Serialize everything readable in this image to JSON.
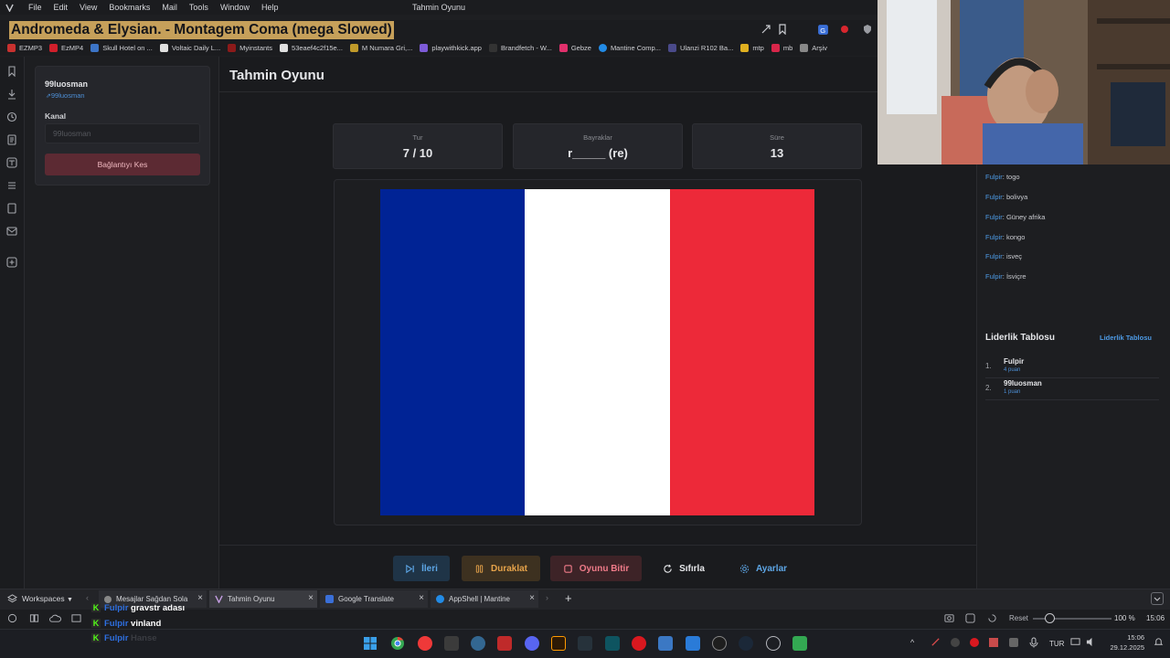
{
  "menubar": {
    "items": [
      "File",
      "Edit",
      "View",
      "Bookmarks",
      "Mail",
      "Tools",
      "Window",
      "Help"
    ],
    "window_title": "Tahmin Oyunu"
  },
  "now_playing": "Andromeda & Elysian. - Montagem Coma (mega Slowed)",
  "bookmarks": [
    "EZMP3",
    "EzMP4",
    "Skull Hotel on ...",
    "Voltaic Daily L...",
    "Myinstants",
    "53eaef4c2f15e...",
    "M Numara Gri,...",
    "playwithkick.app",
    "Brandfetch - W...",
    "Gebze",
    "Mantine Comp...",
    "Ulanzi R102 Ba...",
    "mtp",
    "mb",
    "Arşiv"
  ],
  "sidebar": {
    "username": "99luosman",
    "handle": "99luosman",
    "channel_label": "Kanal",
    "channel_placeholder": "99luosman",
    "disconnect_label": "Bağlantıyı Kes"
  },
  "game": {
    "title": "Tahmin Oyunu",
    "stats": [
      {
        "label": "Tur",
        "value": "7 / 10"
      },
      {
        "label": "Bayraklar",
        "value": "r_____ (re)"
      },
      {
        "label": "Süre",
        "value": "13"
      }
    ],
    "flag_colors": [
      "#002395",
      "#FFFFFF",
      "#ED2939"
    ],
    "actions": [
      {
        "label": "İleri",
        "icon": "skip-icon"
      },
      {
        "label": "Duraklat",
        "icon": "pause-icon"
      },
      {
        "label": "Oyunu Bitir",
        "icon": "stop-icon"
      },
      {
        "label": "Sıfırla",
        "icon": "refresh-icon"
      },
      {
        "label": "Ayarlar",
        "icon": "settings-icon"
      }
    ]
  },
  "chat": [
    {
      "user": "Fulpir",
      "text": "togo"
    },
    {
      "user": "Fulpir",
      "text": "bolivya"
    },
    {
      "user": "Fulpir",
      "text": "Güney afrika"
    },
    {
      "user": "Fulpir",
      "text": "kongo"
    },
    {
      "user": "Fulpir",
      "text": "isveç"
    },
    {
      "user": "Fulpir",
      "text": "İsviçre"
    }
  ],
  "leaderboard": {
    "title": "Liderlik Tablosu",
    "link": "Liderlik Tablosu",
    "rows": [
      {
        "rank": "1.",
        "name": "Fulpir",
        "points": "4 puan"
      },
      {
        "rank": "2.",
        "name": "99luosman",
        "points": "1 puan"
      }
    ]
  },
  "workspaces": {
    "label": "Workspaces",
    "tabs": [
      "Mesajlar Sağdan Sola",
      "Tahmin Oyunu",
      "Google Translate",
      "AppShell | Mantine"
    ]
  },
  "statusbar": {
    "reset": "Reset",
    "zoom": "100 %",
    "time": "15:06"
  },
  "overlay": [
    {
      "user": "Fulpir",
      "text": "gravstr adası"
    },
    {
      "user": "Fulpir",
      "text": "vinland"
    },
    {
      "user": "Fulpir",
      "text": "Hanse"
    }
  ],
  "taskbar": {
    "lang": "TUR",
    "time": "15:06",
    "date": "29.12.2025"
  }
}
